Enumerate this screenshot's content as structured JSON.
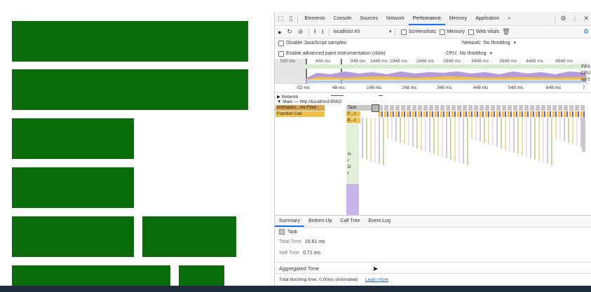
{
  "colors": {
    "block": "#0a6c0a",
    "accent": "#1a73e8",
    "task": "#c8c8c8",
    "script": "#f0c04a",
    "anim": "#d9a255",
    "purple": "#b69bd9",
    "green": "#8bc34a"
  },
  "devtools": {
    "tabs": [
      "Elements",
      "Console",
      "Sources",
      "Network",
      "Performance",
      "Memory",
      "Application",
      "»"
    ],
    "active_tab": "Performance",
    "toolbar": {
      "profile_select": "localhost #3",
      "screenshots": "Screenshots",
      "memory": "Memory",
      "web_vitals": "Web Vitals"
    },
    "options": {
      "disable_js_samples": "Disable JavaScript samples",
      "advanced_paint": "Enable advanced paint instrumentation (slow)",
      "network_label": "Network:",
      "network_value": "No throttling",
      "cpu_label": "CPU:",
      "cpu_value": "No throttling"
    },
    "overview": {
      "ticks": [
        "500 ms",
        "448 ms",
        "948 ms",
        "1448 ms",
        "1948 ms",
        "2448 ms",
        "2948 ms",
        "3448 ms",
        "3948 ms",
        "4448 ms",
        "4948 ms"
      ],
      "labels": {
        "fps": "FPS",
        "cpu": "CPU",
        "net": "NET"
      }
    },
    "ruler": [
      "-52 ms",
      "48 ms",
      "148 ms",
      "248 ms",
      "348 ms",
      "448 ms",
      "548 ms",
      "648 ms",
      "7"
    ],
    "tracks": {
      "network": "▶ Network",
      "main": "▼ Main — http://localhost:8082/",
      "task": "Task",
      "animation": "Animation…me Fired",
      "function_call": "Function Call",
      "f_short": "F…l",
      "e_short": "E…l",
      "letters": [
        "H",
        "r",
        "D",
        "r"
      ]
    },
    "bottom_tabs": [
      "Summary",
      "Bottom-Up",
      "Call Tree",
      "Event Log"
    ],
    "summary": {
      "title": "Task",
      "total_label": "Total Time",
      "total_value": "16.61 ms",
      "self_label": "Self Time",
      "self_value": "0.71 ms",
      "aggregated": "Aggregated Time"
    },
    "footer": {
      "text": "Total blocking time: 0.00ms (estimated)",
      "link": "Learn more"
    }
  }
}
